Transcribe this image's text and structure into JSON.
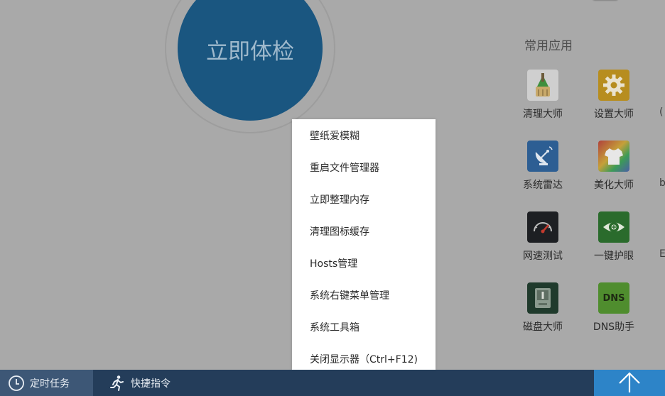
{
  "checkup": {
    "label": "立即体检"
  },
  "apps": {
    "title": "常用应用",
    "items": [
      {
        "label": "清理大师",
        "icon": "broom-icon"
      },
      {
        "label": "设置大师",
        "icon": "gear-icon"
      },
      {
        "label": "系统雷达",
        "icon": "radar-dish-icon"
      },
      {
        "label": "美化大师",
        "icon": "tshirt-icon"
      },
      {
        "label": "网速测试",
        "icon": "speedometer-icon"
      },
      {
        "label": "一键护眼",
        "icon": "eye-icon"
      },
      {
        "label": "磁盘大师",
        "icon": "disk-icon"
      },
      {
        "label": "DNS助手",
        "icon": "dns-icon",
        "icon_text": "DNS"
      }
    ],
    "edge_glyphs": [
      "(",
      "b",
      "E"
    ]
  },
  "context_menu": {
    "items": [
      "壁纸爱模糊",
      "重启文件管理器",
      "立即整理内存",
      "清理图标缓存",
      "Hosts管理",
      "系统右键菜单管理",
      "系统工具箱",
      "关闭显示器（Ctrl+F12)"
    ]
  },
  "bottom_bar": {
    "scheduled_tasks": "定时任务",
    "quick_commands": "快捷指令",
    "up_icon": "arrow-up-icon"
  },
  "colors": {
    "checkup_button": "#1a5680",
    "bottom_bar": "#243d5a",
    "up_button": "#2d84c8",
    "menu_bg": "#ffffff"
  }
}
